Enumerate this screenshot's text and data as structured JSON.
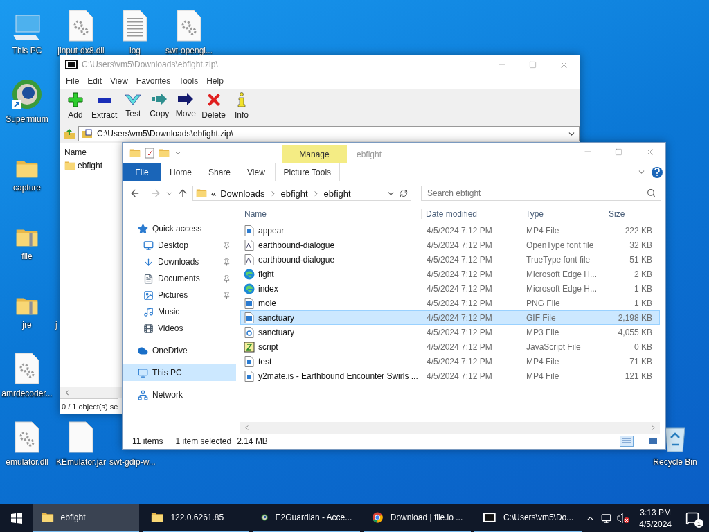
{
  "desktop_icons": [
    {
      "label": "This PC",
      "kind": "pc"
    },
    {
      "label": "jinput-dx8.dll",
      "kind": "gear-file"
    },
    {
      "label": "log",
      "kind": "text-file"
    },
    {
      "label": "swt-opengl...",
      "kind": "gear-file"
    },
    {
      "label": "Supermium",
      "kind": "browser"
    },
    {
      "label": "capture",
      "kind": "folder"
    },
    {
      "label": "file",
      "kind": "zip-folder"
    },
    {
      "label": "jre",
      "kind": "zip-folder"
    },
    {
      "label": "j",
      "kind": "covered"
    },
    {
      "label": "amrdecoder...",
      "kind": "gear-file"
    },
    {
      "label": "emulator.dll",
      "kind": "gear-file"
    },
    {
      "label": "KEmulator.jar",
      "kind": "blank-file"
    },
    {
      "label": "swt-gdip-w...",
      "kind": "covered"
    },
    {
      "label": "Recycle Bin",
      "kind": "recycle"
    }
  ],
  "archive_window": {
    "title": "C:\\Users\\vm5\\Downloads\\ebfight.zip\\",
    "menu": [
      "File",
      "Edit",
      "View",
      "Favorites",
      "Tools",
      "Help"
    ],
    "toolbar": [
      {
        "label": "Add",
        "kind": "add"
      },
      {
        "label": "Extract",
        "kind": "extract"
      },
      {
        "label": "Test",
        "kind": "test"
      },
      {
        "label": "Copy",
        "kind": "copy"
      },
      {
        "label": "Move",
        "kind": "move"
      },
      {
        "label": "Delete",
        "kind": "delete"
      },
      {
        "label": "Info",
        "kind": "info"
      }
    ],
    "address": "C:\\Users\\vm5\\Downloads\\ebfight.zip\\",
    "column": "Name",
    "rows": [
      {
        "name": "ebfight"
      }
    ],
    "status": "0 / 1 object(s) se"
  },
  "explorer_window": {
    "title": "ebfight",
    "context_group": "Manage",
    "ribbon_tabs": [
      {
        "label": "File",
        "kind": "file"
      },
      {
        "label": "Home",
        "kind": "plain"
      },
      {
        "label": "Share",
        "kind": "plain"
      },
      {
        "label": "View",
        "kind": "plain"
      },
      {
        "label": "Picture Tools",
        "kind": "context"
      }
    ],
    "path_overflow": "«",
    "breadcrumb": [
      "Downloads",
      "ebfight",
      "ebfight"
    ],
    "search": {
      "placeholder": "Search ebfight"
    },
    "nav": [
      {
        "label": "Quick access",
        "kind": "star",
        "pinned": false,
        "selected": false,
        "children": [
          {
            "label": "Desktop",
            "kind": "desktop",
            "pinned": true,
            "selected": false
          },
          {
            "label": "Downloads",
            "kind": "downloads",
            "pinned": true,
            "selected": false
          },
          {
            "label": "Documents",
            "kind": "documents",
            "pinned": true,
            "selected": false
          },
          {
            "label": "Pictures",
            "kind": "pictures",
            "pinned": true,
            "selected": false
          },
          {
            "label": "Music",
            "kind": "music",
            "pinned": false,
            "selected": false
          },
          {
            "label": "Videos",
            "kind": "videos",
            "pinned": false,
            "selected": false
          }
        ]
      },
      {
        "label": "OneDrive",
        "kind": "cloud",
        "pinned": false,
        "selected": false
      },
      {
        "label": "This PC",
        "kind": "pc",
        "pinned": false,
        "selected": true
      },
      {
        "label": "Network",
        "kind": "network",
        "pinned": false,
        "selected": false
      }
    ],
    "columns": [
      "Name",
      "Date modified",
      "Type",
      "Size"
    ],
    "rows": [
      {
        "name": "appear",
        "date": "4/5/2024 7:12 PM",
        "type": "MP4 File",
        "size": "222 KB",
        "kind": "video",
        "selected": false
      },
      {
        "name": "earthbound-dialogue",
        "date": "4/5/2024 7:12 PM",
        "type": "OpenType font file",
        "size": "32 KB",
        "kind": "font",
        "selected": false
      },
      {
        "name": "earthbound-dialogue",
        "date": "4/5/2024 7:12 PM",
        "type": "TrueType font file",
        "size": "51 KB",
        "kind": "font",
        "selected": false
      },
      {
        "name": "fight",
        "date": "4/5/2024 7:12 PM",
        "type": "Microsoft Edge H...",
        "size": "2 KB",
        "kind": "edge",
        "selected": false
      },
      {
        "name": "index",
        "date": "4/5/2024 7:12 PM",
        "type": "Microsoft Edge H...",
        "size": "1 KB",
        "kind": "edge",
        "selected": false
      },
      {
        "name": "mole",
        "date": "4/5/2024 7:12 PM",
        "type": "PNG File",
        "size": "1 KB",
        "kind": "image",
        "selected": false
      },
      {
        "name": "sanctuary",
        "date": "4/5/2024 7:12 PM",
        "type": "GIF File",
        "size": "2,198 KB",
        "kind": "image",
        "selected": true
      },
      {
        "name": "sanctuary",
        "date": "4/5/2024 7:12 PM",
        "type": "MP3 File",
        "size": "4,055 KB",
        "kind": "audio",
        "selected": false
      },
      {
        "name": "script",
        "date": "4/5/2024 7:12 PM",
        "type": "JavaScript File",
        "size": "0 KB",
        "kind": "script",
        "selected": false
      },
      {
        "name": "test",
        "date": "4/5/2024 7:12 PM",
        "type": "MP4 File",
        "size": "71 KB",
        "kind": "video",
        "selected": false
      },
      {
        "name": "y2mate.is - Earthbound Encounter Swirls ...",
        "date": "4/5/2024 7:12 PM",
        "type": "MP4 File",
        "size": "121 KB",
        "kind": "video",
        "selected": false
      }
    ],
    "status": {
      "count": "11 items",
      "selection": "1 item selected",
      "selection_size": "2.14 MB"
    }
  },
  "taskbar": {
    "items": [
      {
        "label": "ebfight",
        "kind": "folder",
        "selected": true
      },
      {
        "label": "122.0.6261.85",
        "kind": "folder",
        "selected": false
      },
      {
        "label": "E2Guardian - Acce...",
        "kind": "browser",
        "selected": false
      },
      {
        "label": "Download | file.io ...",
        "kind": "chrome",
        "selected": false
      },
      {
        "label": "C:\\Users\\vm5\\Do...",
        "kind": "archive",
        "selected": false
      }
    ],
    "time": "3:13 PM",
    "date": "4/5/2024",
    "notification_count": "1"
  }
}
